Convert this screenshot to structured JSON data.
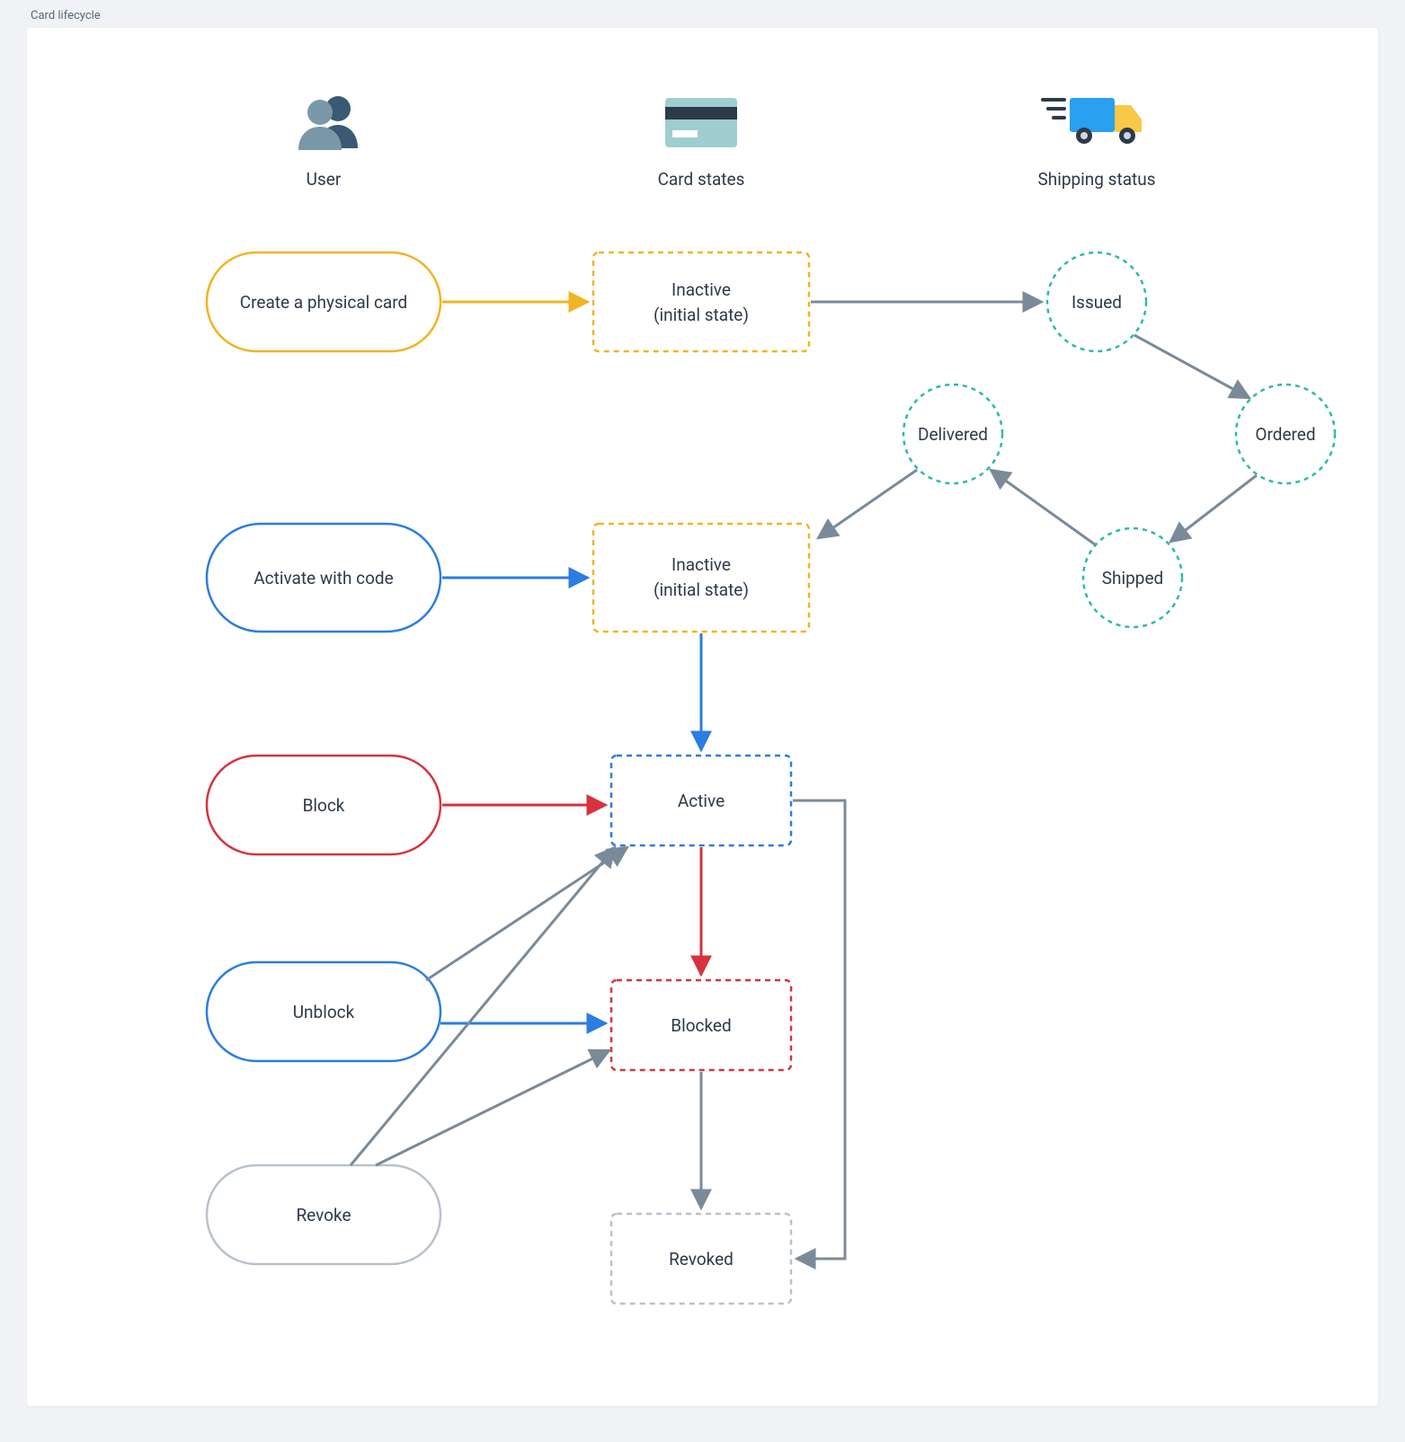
{
  "title": "Card lifecycle",
  "columns": {
    "user": "User",
    "card_states": "Card states",
    "shipping_status": "Shipping status"
  },
  "nodes": {
    "create_card": "Create a physical card",
    "inactive_1_l1": "Inactive",
    "inactive_1_l2": "(initial state)",
    "issued": "Issued",
    "ordered": "Ordered",
    "shipped": "Shipped",
    "delivered": "Delivered",
    "activate": "Activate with code",
    "inactive_2_l1": "Inactive",
    "inactive_2_l2": "(initial state)",
    "block": "Block",
    "active": "Active",
    "unblock": "Unblock",
    "blocked": "Blocked",
    "revoke": "Revoke",
    "revoked": "Revoked"
  },
  "colors": {
    "teal": "#2fb8ac",
    "slate": "#3a5a73",
    "slateLight": "#7a8a99",
    "blue": "#2b7de0",
    "yellow": "#f1b422",
    "red": "#d6333f",
    "gray": "#8b97a3",
    "arrow": "#7a8a99",
    "cardTeal": "#9fcdd0",
    "truckBlue": "#2aa0f0",
    "truckYellow": "#f9c846"
  }
}
